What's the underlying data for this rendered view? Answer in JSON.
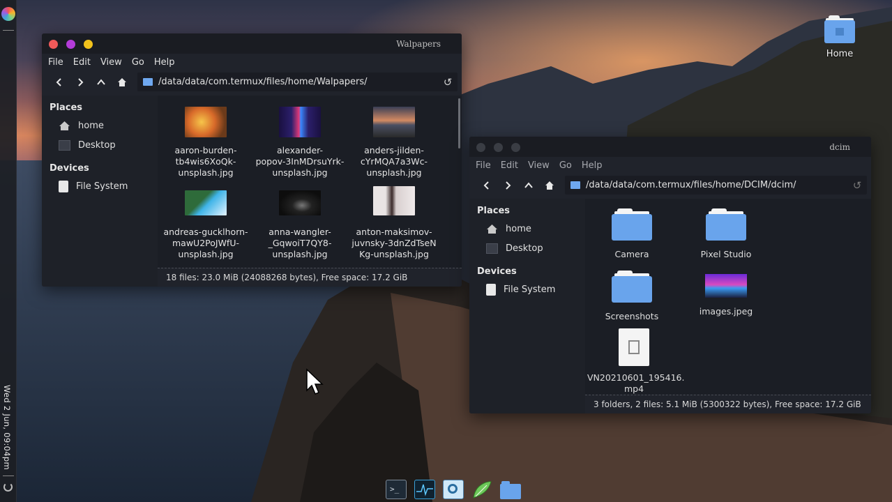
{
  "panel": {
    "clock": "Wed  2 Jun, 09:04pm"
  },
  "desktop": {
    "icons": [
      {
        "label": "Home",
        "icon": "home-folder-icon"
      }
    ]
  },
  "dock": {
    "items": [
      "terminal-icon",
      "system-monitor-icon",
      "image-viewer-icon",
      "text-editor-icon",
      "file-manager-icon"
    ]
  },
  "windows": {
    "wallpapers": {
      "title": "Walpapers",
      "menu": [
        "File",
        "Edit",
        "View",
        "Go",
        "Help"
      ],
      "path": "/data/data/com.termux/files/home/Walpapers/",
      "sidebar": {
        "places_heading": "Places",
        "places": [
          "home",
          "Desktop"
        ],
        "devices_heading": "Devices",
        "devices": [
          "File System"
        ]
      },
      "files": [
        {
          "name": "aaron-burden-tb4wis6XoQk-unsplash.jpg",
          "lines": [
            "aaron-burden-",
            "tb4wis6XoQk-",
            "unsplash.jpg"
          ]
        },
        {
          "name": "alexander-popov-3InMDrsuYrk-unsplash.jpg",
          "lines": [
            "alexander-",
            "popov-3InMDrsuYrk-",
            "unsplash.jpg"
          ]
        },
        {
          "name": "anders-jilden-cYrMQA7a3Wc-unsplash.jpg",
          "lines": [
            "anders-jilden-",
            "cYrMQA7a3Wc-",
            "unsplash.jpg"
          ]
        },
        {
          "name": "andreas-gucklhorn-mawU2PoJWfU-unsplash.jpg",
          "lines": [
            "andreas-gucklhorn-",
            "mawU2PoJWfU-",
            "unsplash.jpg"
          ]
        },
        {
          "name": "anna-wangler-_GqwoiT7QY8-unsplash.jpg",
          "lines": [
            "anna-wangler-",
            "_GqwoiT7QY8-",
            "unsplash.jpg"
          ]
        },
        {
          "name": "anton-maksimov-juvnsky-3dnZdTseNKg-unsplash.jpg",
          "lines": [
            "anton-maksimov-",
            "juvnsky-3dnZdTseN",
            "Kg-unsplash.jpg"
          ]
        }
      ],
      "status": "18 files: 23.0 MiB (24088268 bytes), Free space: 17.2 GiB"
    },
    "dcim": {
      "title": "dcim",
      "menu": [
        "File",
        "Edit",
        "View",
        "Go",
        "Help"
      ],
      "path": "/data/data/com.termux/files/home/DCIM/dcim/",
      "sidebar": {
        "places_heading": "Places",
        "places": [
          "home",
          "Desktop"
        ],
        "devices_heading": "Devices",
        "devices": [
          "File System"
        ]
      },
      "items": [
        {
          "name": "Camera",
          "type": "folder"
        },
        {
          "name": "Pixel Studio",
          "type": "folder"
        },
        {
          "name": "Screenshots",
          "type": "folder"
        },
        {
          "name": "images.jpeg",
          "type": "image"
        },
        {
          "name": "VN20210601_195416.mp4",
          "lines": [
            "VN20210601_195416.",
            "mp4"
          ],
          "type": "video"
        }
      ],
      "status": "3 folders, 2 files: 5.1 MiB (5300322 bytes), Free space: 17.2 GiB"
    }
  },
  "colors": {
    "close": "#f05a5a",
    "minimize": "#b43cd9",
    "maximize": "#f2c21c",
    "inactive_button": "#3a3d44",
    "folder_blue": "#69a4ec"
  }
}
